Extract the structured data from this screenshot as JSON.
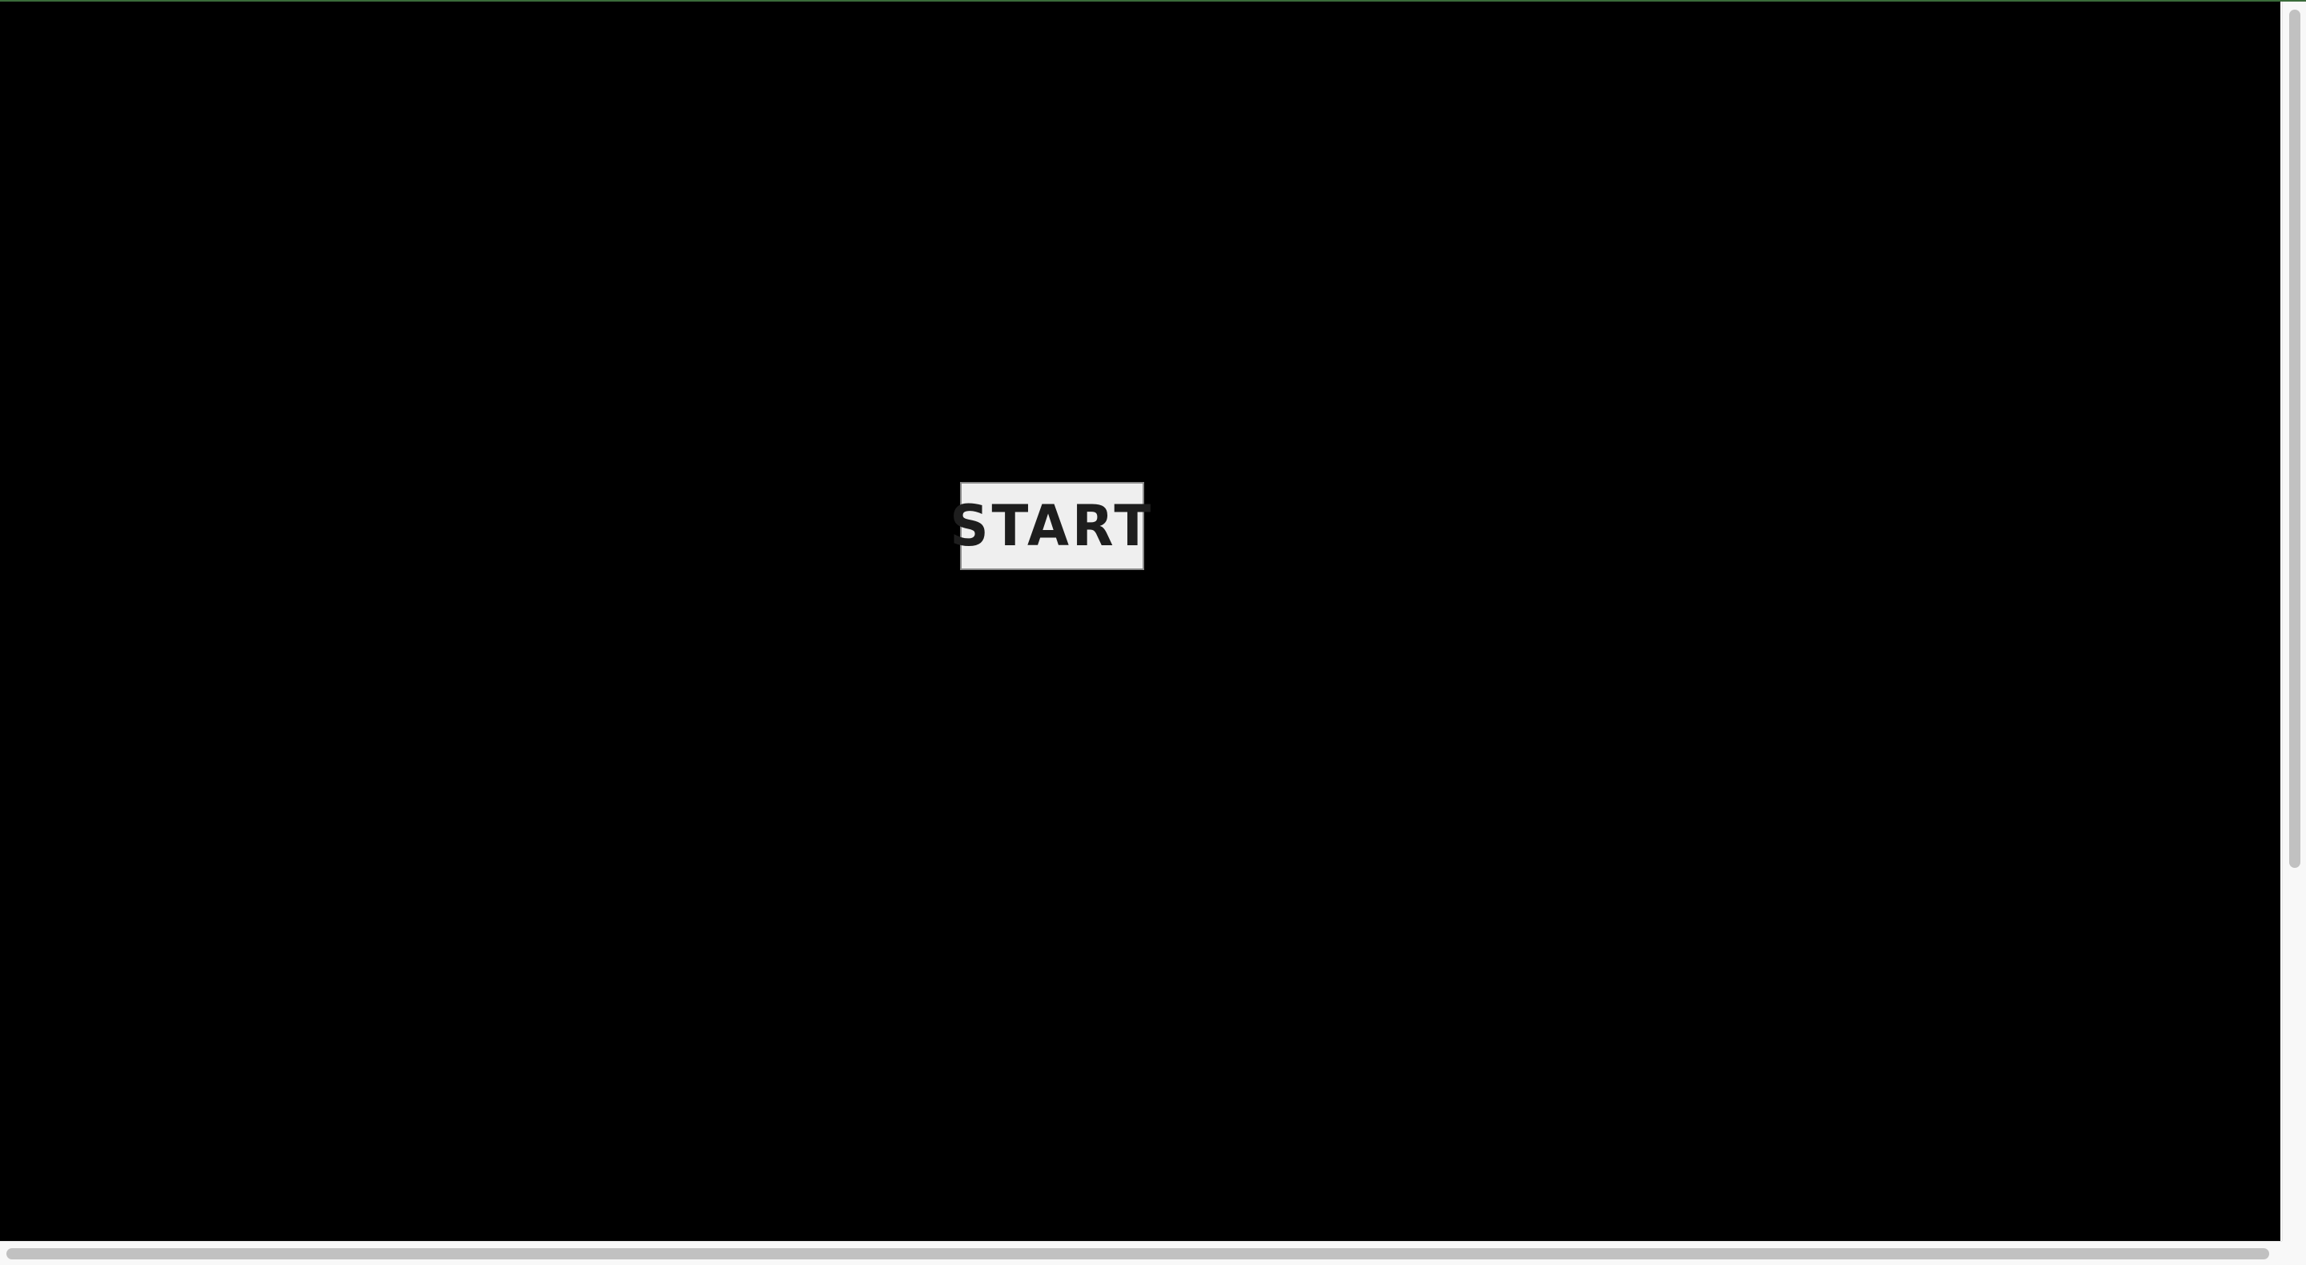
{
  "game": {
    "start_button": {
      "label": "START"
    }
  },
  "colors": {
    "canvas_background": "#000000",
    "button_background": "#efefef",
    "button_border": "#8a8a8a",
    "button_text": "#1e1e1e",
    "top_accent": "#3a6b3a",
    "scrollbar_track": "#f8f8f8",
    "scrollbar_thumb": "#c1c1c1"
  }
}
